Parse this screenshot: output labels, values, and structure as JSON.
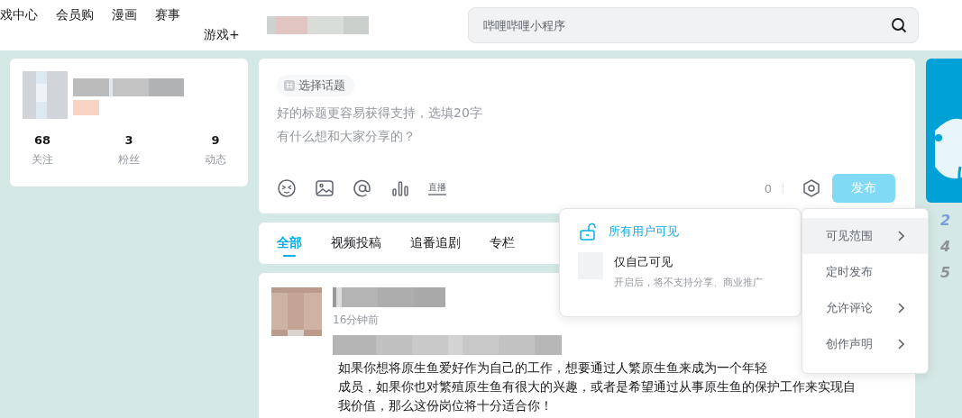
{
  "nav": {
    "items": [
      "戏中心",
      "会员购",
      "漫画",
      "赛事"
    ],
    "game_plus": "游戏+"
  },
  "search": {
    "placeholder": "哔哩哔哩小程序"
  },
  "profile": {
    "stats": [
      {
        "value": "68",
        "label": "关注"
      },
      {
        "value": "3",
        "label": "粉丝"
      },
      {
        "value": "9",
        "label": "动态"
      }
    ]
  },
  "editor": {
    "topic_button": "选择话题",
    "title_placeholder": "好的标题更容易获得支持，选填20字",
    "body_placeholder": "有什么想和大家分享的？",
    "live_icon_text": "直播",
    "count": "0",
    "publish": {
      "label": "发布",
      "disabled": true
    }
  },
  "tabs": [
    {
      "label": "全部",
      "selected": true
    },
    {
      "label": "视频投稿",
      "selected": false
    },
    {
      "label": "追番追剧",
      "selected": false
    },
    {
      "label": "专栏",
      "selected": false
    }
  ],
  "visibility_options": [
    {
      "kind": "lock",
      "label": "所有用户可见",
      "selected": true
    },
    {
      "kind": "box",
      "label": "仅自己可见",
      "hint": "开启后，将不支持分享、商业推广",
      "selected": false
    }
  ],
  "settings_menu": [
    {
      "label": "可见范围",
      "has_submenu": true,
      "selected": true
    },
    {
      "label": "定时发布",
      "has_submenu": false,
      "selected": false
    },
    {
      "label": "允许评论",
      "has_submenu": true,
      "selected": false
    },
    {
      "label": "创作声明",
      "has_submenu": true,
      "selected": false
    }
  ],
  "post": {
    "time": "16分钟前",
    "lines": [
      "如果你想将原生鱼爱好作为自己的工作，想要通过人繁原生鱼来成为一个年轻",
      "成员，如果你也对繁殖原生鱼有很大的兴趣，或者是希望通过从事原生鱼的保护工作来实现自",
      "我价值，那么这份岗位将十分适合你！"
    ]
  },
  "ranking": [
    "2",
    "4",
    "5"
  ]
}
